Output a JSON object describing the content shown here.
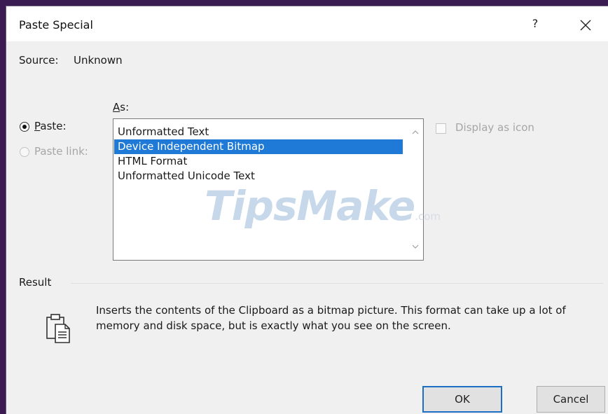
{
  "dialog": {
    "title": "Paste Special",
    "help_label": "?",
    "close_icon": "close-icon"
  },
  "source": {
    "label": "Source:",
    "value": "Unknown"
  },
  "options": {
    "as_label": "As:",
    "paste_label": "Paste:",
    "paste_link_label": "Paste link:",
    "selected_option": "paste"
  },
  "list": {
    "items": [
      "Unformatted Text",
      "Device Independent Bitmap",
      "HTML Format",
      "Unformatted Unicode Text"
    ],
    "selected_index": 1
  },
  "display_as_icon": {
    "label": "Display as icon",
    "checked": false
  },
  "watermark": {
    "text": "TipsMake",
    "suffix": ".com"
  },
  "result": {
    "label": "Result",
    "description": "Inserts the contents of the Clipboard as a bitmap picture. This format can take up a lot of memory and disk space, but is exactly what you see on the screen.",
    "icon": "clipboard-paste-icon"
  },
  "buttons": {
    "ok": "OK",
    "cancel": "Cancel"
  },
  "colors": {
    "selection": "#1e7ad6",
    "default_button_border": "#1b6fc4",
    "window_frame": "#3b1c52"
  }
}
